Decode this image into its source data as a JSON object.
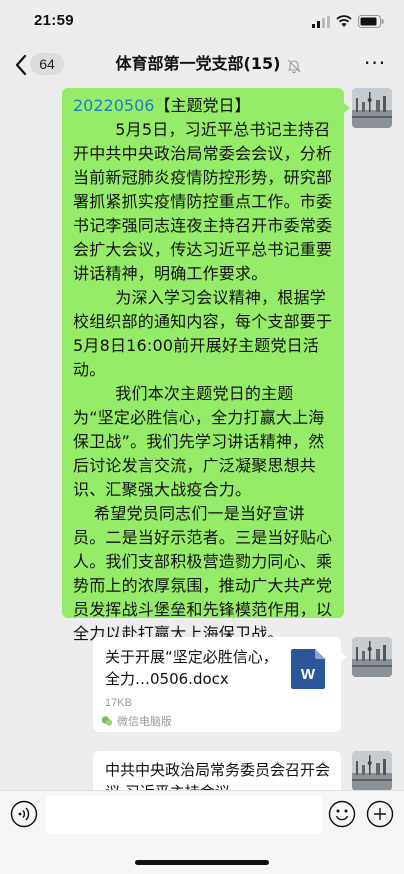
{
  "status_bar": {
    "time": "21:59"
  },
  "nav": {
    "unread_count": "64",
    "chat_title": "体育部第一党支部(15)",
    "more_label": "···"
  },
  "message": {
    "date": "20220506",
    "tag": "【主题党日】",
    "paragraphs": [
      "        5月5日，习近平总书记主持召开中共中央政治局常委会会议，分析当前新冠肺炎疫情防控形势，研究部署抓紧抓实疫情防控重点工作。市委书记李强同志连夜主持召开市委常委会扩大会议，传达习近平总书记重要讲话精神，明确工作要求。",
      "        为深入学习会议精神，根据学校组织部的通知内容，每个支部要于5月8日16:00前开展好主题党日活动。",
      "        我们本次主题党日的主题为“坚定必胜信心，全力打赢大上海保卫战”。我们先学习讲话精神，然后讨论发言交流，广泛凝聚思想共识、汇聚强大战疫合力。",
      "    希望党员同志们一是当好宣讲员。二是当好示范者。三是当好贴心人。我们支部积极营造勠力同心、乘势而上的浓厚氛围，推动广大共产党员发挥战斗堡垒和先锋模范作用，以全力以赴打赢大上海保卫战。"
    ]
  },
  "file_card": {
    "name": "关于开展“坚定必胜信心，全力…0506.docx",
    "size": "17KB",
    "source": "微信电脑版"
  },
  "second_card": {
    "text": "中共中央政治局常务委员会召开会议 习近平主持会议"
  },
  "colors": {
    "bubble_green": "#95ec69",
    "date_blue": "#1e7fbf",
    "word_blue": "#2b579a"
  },
  "icons": [
    "back-chevron-icon",
    "mute-icon",
    "more-icon",
    "word-file-icon",
    "wechat-pc-icon",
    "voice-icon",
    "emoji-icon",
    "plus-icon"
  ]
}
